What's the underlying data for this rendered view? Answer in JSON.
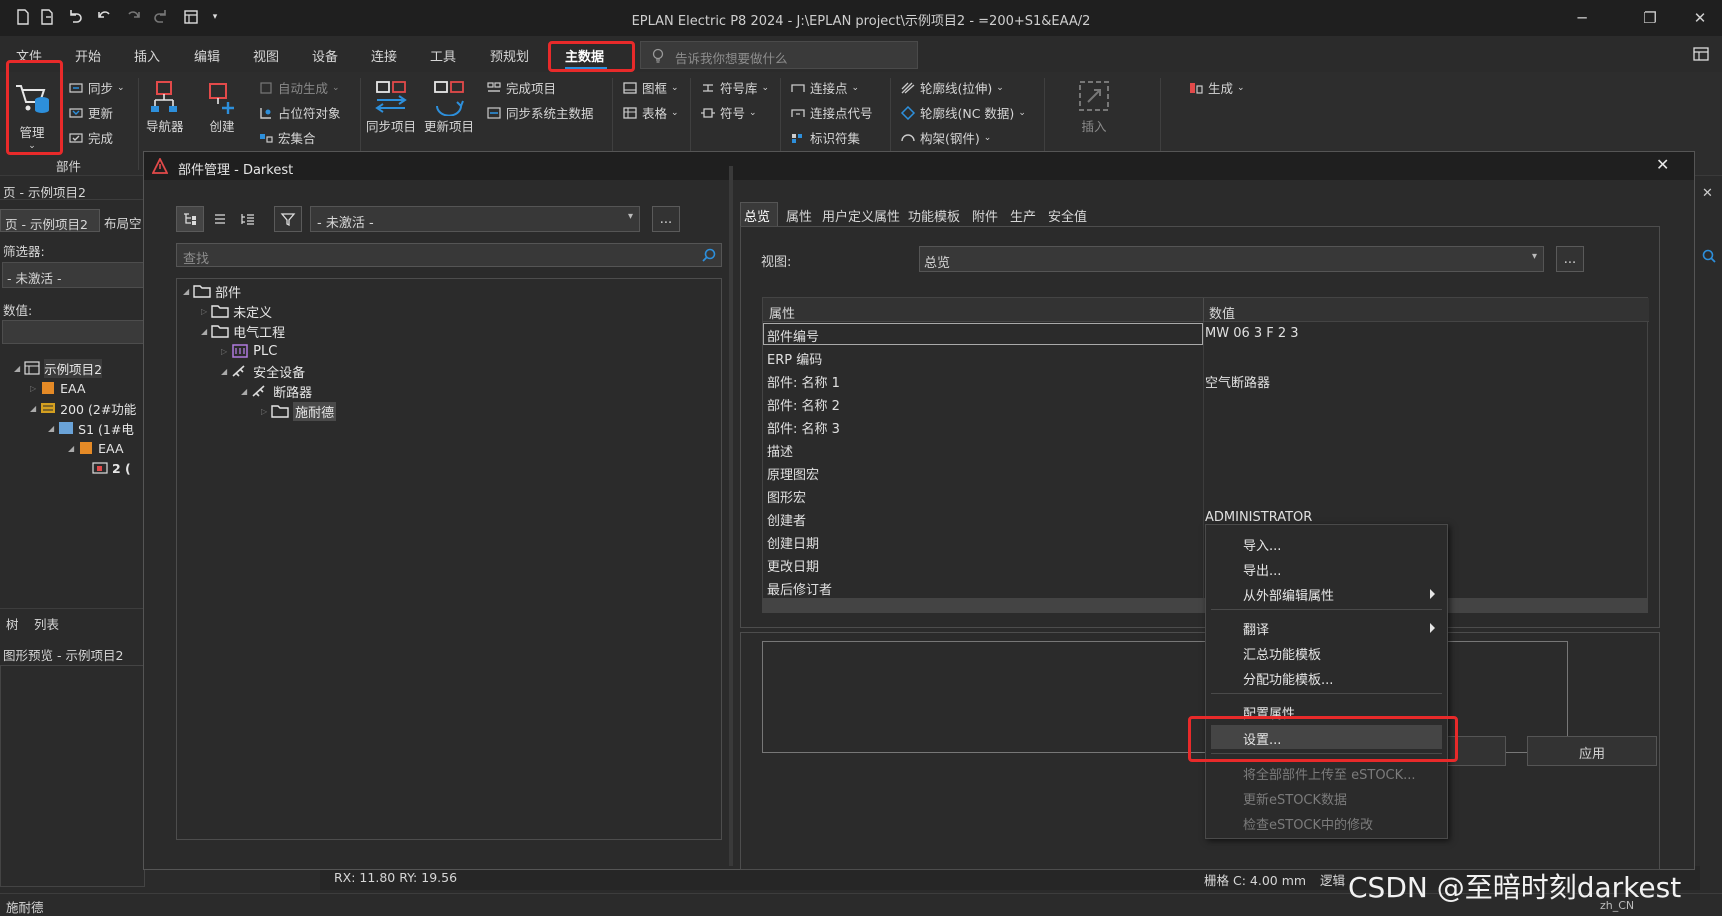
{
  "window": {
    "title": "EPLAN Electric P8 2024 - J:\\EPLAN project\\示例项目2 - =200+S1&EAA/2"
  },
  "menu": {
    "items": [
      "文件",
      "开始",
      "插入",
      "编辑",
      "视图",
      "设备",
      "连接",
      "工具",
      "预规划",
      "主数据"
    ],
    "active": "主数据",
    "search_placeholder": "告诉我你想要做什么"
  },
  "ribbon": {
    "manage": "管理",
    "sync": "同步",
    "update": "更新",
    "complete": "完成",
    "group_parts": "部件",
    "navigator": "导航器",
    "create": "创建",
    "auto_generate": "自动生成",
    "placeholder_object": "占位符对象",
    "macro_set": "宏集合",
    "sync_project": "同步项目",
    "update_project": "更新项目",
    "complete_project": "完成项目",
    "sync_system_master": "同步系统主数据",
    "frame": "图框",
    "table": "表格",
    "symbol_lib": "符号库",
    "symbol": "符号",
    "connection_point": "连接点",
    "connection_point_code": "连接点代号",
    "identifier_set": "标识符集",
    "outline_stretch": "轮廓线(拉伸)",
    "outline_nc": "轮廓线(NC 数据)",
    "structure_steel": "构架(钢件)",
    "insert": "插入",
    "generate": "生成"
  },
  "left_panel": {
    "page_header": "页 - 示例项目2",
    "tab_page": "页 - 示例项目2",
    "tab_layout": "布局空",
    "filter_label": "筛选器:",
    "filter_value": "- 未激活 -",
    "value_label": "数值:",
    "tree": [
      "示例项目2",
      "EAA",
      "200 (2#功能",
      "S1 (1#电",
      "EAA",
      "2 ("
    ],
    "tab_tree": "树",
    "tab_list": "列表",
    "preview_header": "图形预览 - 示例项目2"
  },
  "dialog": {
    "title": "部件管理 - Darkest",
    "filter_value": "- 未激活 -",
    "more": "...",
    "search_placeholder": "查找",
    "tree": [
      "部件",
      "未定义",
      "电气工程",
      "PLC",
      "安全设备",
      "断路器",
      "施耐德"
    ],
    "tabs": [
      "总览",
      "属性",
      "用户定义属性",
      "功能模板",
      "附件",
      "生产",
      "安全值"
    ],
    "view_label": "视图:",
    "view_value": "总览",
    "grid_headers": [
      "属性",
      "数值"
    ],
    "grid_rows": [
      {
        "prop": "部件编号",
        "value": "MW 06 3 F 2 3"
      },
      {
        "prop": "ERP 编码",
        "value": ""
      },
      {
        "prop": "部件: 名称 1",
        "value": "空气断路器"
      },
      {
        "prop": "部件: 名称 2",
        "value": ""
      },
      {
        "prop": "部件: 名称 3",
        "value": ""
      },
      {
        "prop": "描述",
        "value": ""
      },
      {
        "prop": "原理图宏",
        "value": ""
      },
      {
        "prop": "图形宏",
        "value": ""
      },
      {
        "prop": "创建者",
        "value": "ADMINISTRATOR"
      },
      {
        "prop": "创建日期",
        "value": ""
      },
      {
        "prop": "更改日期",
        "value": ""
      },
      {
        "prop": "最后修订者",
        "value": ""
      }
    ],
    "apply": "应用"
  },
  "context_menu": {
    "items": [
      {
        "label": "导入..."
      },
      {
        "label": "导出..."
      },
      {
        "label": "从外部编辑属性"
      },
      {
        "label": "翻译"
      },
      {
        "label": "汇总功能模板"
      },
      {
        "label": "分配功能模板..."
      },
      {
        "label": "配置属性..."
      },
      {
        "label": "设置..."
      },
      {
        "label": "将全部部件上传至 eSTOCK..."
      },
      {
        "label": "更新eSTOCK数据"
      },
      {
        "label": "检查eSTOCK中的修改"
      }
    ]
  },
  "status": {
    "coords": "RX: 11.80 RY: 19.56",
    "grid": "栅格 C: 4.00 mm",
    "logic": "逻辑",
    "locale": "zh_CN",
    "bottom_left": "施耐德"
  },
  "watermark": "CSDN @至暗时刻darkest",
  "colors": {
    "highlight_red": "#e82a2a",
    "accent_blue": "#2d8fdb",
    "folder_white": "#e6e6e6"
  }
}
